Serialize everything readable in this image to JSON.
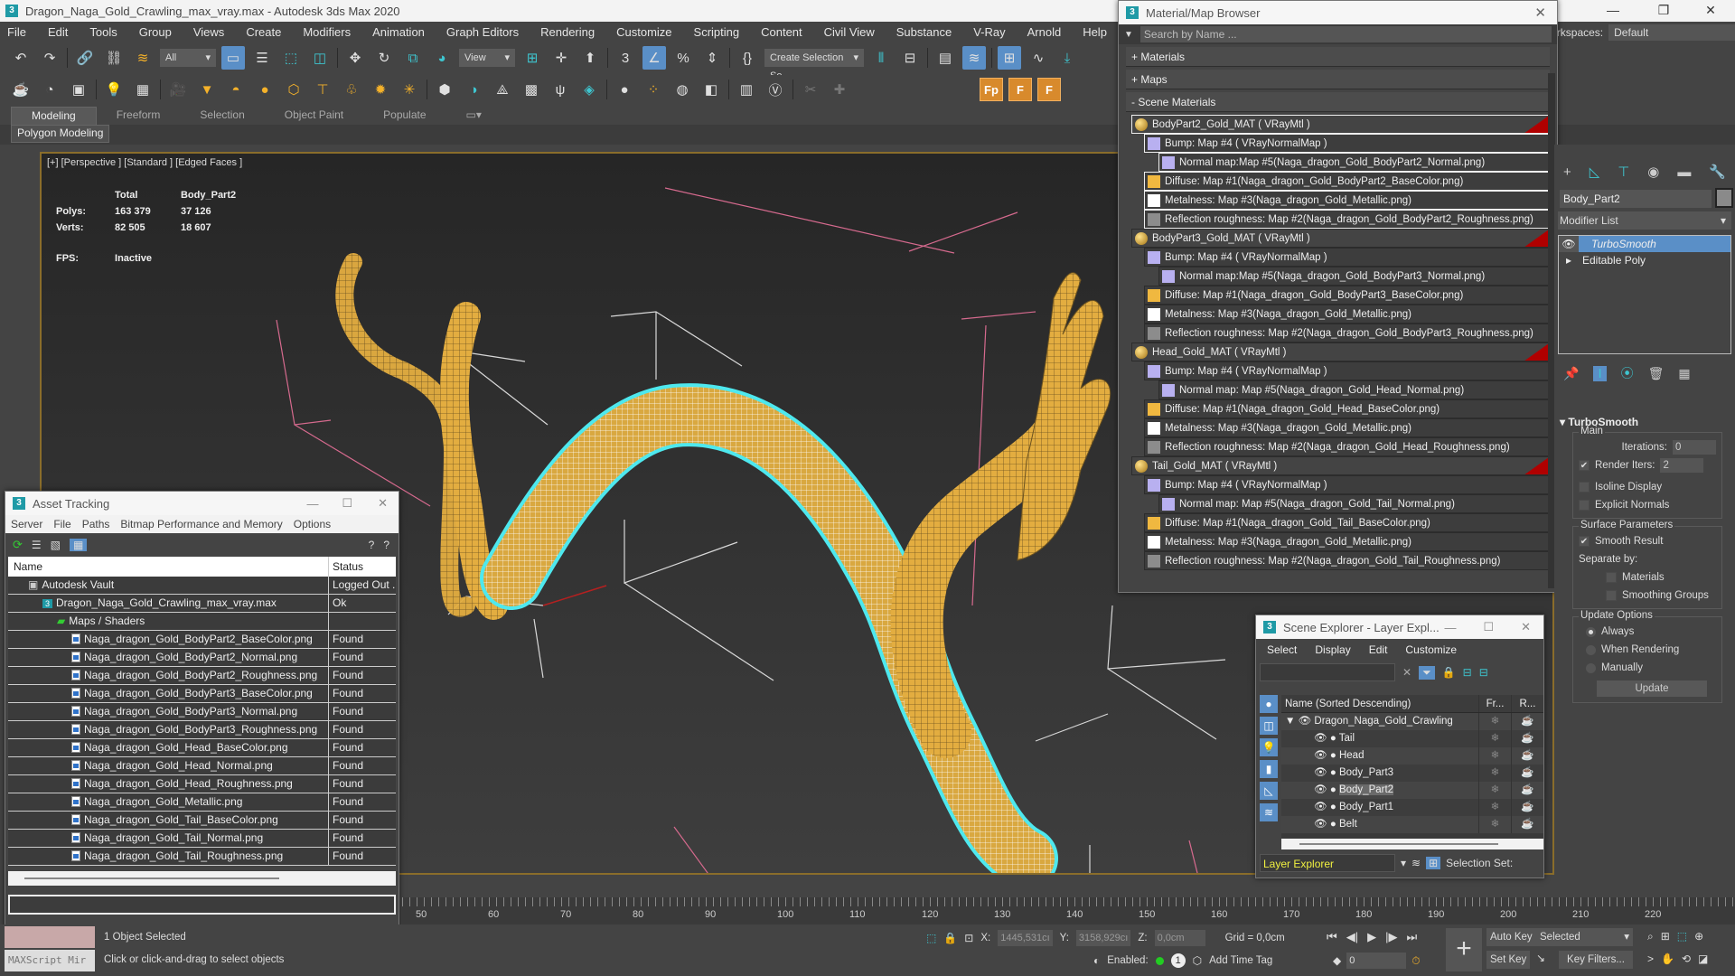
{
  "app": {
    "title": "Dragon_Naga_Gold_Crawling_max_vray.max - Autodesk 3ds Max 2020",
    "menu": [
      "File",
      "Edit",
      "Tools",
      "Group",
      "Views",
      "Create",
      "Modifiers",
      "Animation",
      "Graph Editors",
      "Rendering",
      "Customize",
      "Scripting",
      "Content",
      "Civil View",
      "Substance",
      "V-Ray",
      "Arnold",
      "Help"
    ],
    "workspaces_label": "Workspaces:",
    "workspace_value": "Default"
  },
  "toolbar": {
    "selection_filter": "All",
    "reference_coord": "View",
    "named_selection_sets": "Create Selection Se",
    "fp_buttons": [
      "Fp",
      "F",
      "F"
    ]
  },
  "ribbon": {
    "tabs": [
      "Modeling",
      "Freeform",
      "Selection",
      "Object Paint",
      "Populate"
    ],
    "active_tab": "Modeling",
    "panel": "Polygon Modeling"
  },
  "viewport": {
    "label": "[+] [Perspective ] [Standard ] [Edged Faces ]",
    "stats": {
      "col_total": "Total",
      "col_object": "Body_Part2",
      "polys_label": "Polys:",
      "polys_total": "163 379",
      "polys_object": "37 126",
      "verts_label": "Verts:",
      "verts_total": "82 505",
      "verts_object": "18 607",
      "fps_label": "FPS:",
      "fps_value": "Inactive"
    },
    "colors": {
      "mesh": "#e0aa3a",
      "selection": "#4ee8ee",
      "border": "#8a6d2b"
    }
  },
  "material_browser": {
    "title": "Material/Map Browser",
    "search_placeholder": "Search by Name ...",
    "sections": [
      "+ Materials",
      "+ Maps",
      "- Scene Materials"
    ],
    "materials": [
      {
        "name": "BodyPart2_Gold_MAT  ( VRayMtl )",
        "maps": [
          "Bump: Map #4  ( VRayNormalMap )",
          "Normal map:Map #5(Naga_dragon_Gold_BodyPart2_Normal.png)",
          "Diffuse: Map #1(Naga_dragon_Gold_BodyPart2_BaseColor.png)",
          "Metalness: Map #3(Naga_dragon_Gold_Metallic.png)",
          "Reflection roughness: Map #2(Naga_dragon_Gold_BodyPart2_Roughness.png)"
        ]
      },
      {
        "name": "BodyPart3_Gold_MAT  ( VRayMtl )",
        "maps": [
          "Bump: Map #4  ( VRayNormalMap )",
          "Normal map:Map #5(Naga_dragon_Gold_BodyPart3_Normal.png)",
          "Diffuse: Map #1(Naga_dragon_Gold_BodyPart3_BaseColor.png)",
          "Metalness: Map #3(Naga_dragon_Gold_Metallic.png)",
          "Reflection roughness: Map #2(Naga_dragon_Gold_BodyPart3_Roughness.png)"
        ]
      },
      {
        "name": "Head_Gold_MAT  ( VRayMtl )",
        "maps": [
          "Bump: Map #4  ( VRayNormalMap )",
          "Normal map: Map #5(Naga_dragon_Gold_Head_Normal.png)",
          "Diffuse: Map #1(Naga_dragon_Gold_Head_BaseColor.png)",
          "Metalness: Map #3(Naga_dragon_Gold_Metallic.png)",
          "Reflection roughness: Map #2(Naga_dragon_Gold_Head_Roughness.png)"
        ]
      },
      {
        "name": "Tail_Gold_MAT  ( VRayMtl )",
        "maps": [
          "Bump: Map #4  ( VRayNormalMap )",
          "Normal map: Map #5(Naga_dragon_Gold_Tail_Normal.png)",
          "Diffuse: Map #1(Naga_dragon_Gold_Tail_BaseColor.png)",
          "Metalness: Map #3(Naga_dragon_Gold_Metallic.png)",
          "Reflection roughness: Map #2(Naga_dragon_Gold_Tail_Roughness.png)"
        ]
      }
    ]
  },
  "asset_tracking": {
    "title": "Asset Tracking",
    "menu": [
      "Server",
      "File",
      "Paths",
      "Bitmap Performance and Memory",
      "Options"
    ],
    "columns": [
      "Name",
      "Status"
    ],
    "rows": [
      {
        "name": "Autodesk Vault",
        "status": "Logged Out .",
        "level": 1,
        "icon": "vault"
      },
      {
        "name": "Dragon_Naga_Gold_Crawling_max_vray.max",
        "status": "Ok",
        "level": 2,
        "icon": "max"
      },
      {
        "name": "Maps / Shaders",
        "status": "",
        "level": 3,
        "icon": "maps"
      },
      {
        "name": "Naga_dragon_Gold_BodyPart2_BaseColor.png",
        "status": "Found",
        "level": 4,
        "icon": "file"
      },
      {
        "name": "Naga_dragon_Gold_BodyPart2_Normal.png",
        "status": "Found",
        "level": 4,
        "icon": "file"
      },
      {
        "name": "Naga_dragon_Gold_BodyPart2_Roughness.png",
        "status": "Found",
        "level": 4,
        "icon": "file"
      },
      {
        "name": "Naga_dragon_Gold_BodyPart3_BaseColor.png",
        "status": "Found",
        "level": 4,
        "icon": "file"
      },
      {
        "name": "Naga_dragon_Gold_BodyPart3_Normal.png",
        "status": "Found",
        "level": 4,
        "icon": "file"
      },
      {
        "name": "Naga_dragon_Gold_BodyPart3_Roughness.png",
        "status": "Found",
        "level": 4,
        "icon": "file"
      },
      {
        "name": "Naga_dragon_Gold_Head_BaseColor.png",
        "status": "Found",
        "level": 4,
        "icon": "file"
      },
      {
        "name": "Naga_dragon_Gold_Head_Normal.png",
        "status": "Found",
        "level": 4,
        "icon": "file"
      },
      {
        "name": "Naga_dragon_Gold_Head_Roughness.png",
        "status": "Found",
        "level": 4,
        "icon": "file"
      },
      {
        "name": "Naga_dragon_Gold_Metallic.png",
        "status": "Found",
        "level": 4,
        "icon": "file"
      },
      {
        "name": "Naga_dragon_Gold_Tail_BaseColor.png",
        "status": "Found",
        "level": 4,
        "icon": "file"
      },
      {
        "name": "Naga_dragon_Gold_Tail_Normal.png",
        "status": "Found",
        "level": 4,
        "icon": "file"
      },
      {
        "name": "Naga_dragon_Gold_Tail_Roughness.png",
        "status": "Found",
        "level": 4,
        "icon": "file"
      }
    ]
  },
  "scene_explorer": {
    "title": "Scene Explorer - Layer Expl...",
    "menu": [
      "Select",
      "Display",
      "Edit",
      "Customize"
    ],
    "columns": [
      "Name (Sorted Descending)",
      "Fr...",
      "R..."
    ],
    "root": "Dragon_Naga_Gold_Crawling",
    "objects": [
      "Tail",
      "Head",
      "Body_Part3",
      "Body_Part2",
      "Body_Part1",
      "Belt"
    ],
    "selected": "Body_Part2",
    "explorer_mode": "Layer Explorer",
    "selection_set_label": "Selection Set:"
  },
  "command_panel": {
    "object_name": "Body_Part2",
    "modifier_list_label": "Modifier List",
    "stack": [
      "TurboSmooth",
      "Editable Poly"
    ],
    "selected_modifier": "TurboSmooth",
    "rollout": {
      "title": "TurboSmooth",
      "main_label": "Main",
      "iterations_label": "Iterations:",
      "iterations_value": "0",
      "render_iters_label": "Render Iters:",
      "render_iters_value": "2",
      "render_iters_checked": true,
      "isoline_label": "Isoline Display",
      "explicit_normals_label": "Explicit Normals",
      "surface_label": "Surface Parameters",
      "smooth_result_label": "Smooth Result",
      "separate_by_label": "Separate by:",
      "materials_label": "Materials",
      "smoothing_groups_label": "Smoothing Groups",
      "update_options_label": "Update Options",
      "radio_options": [
        "Always",
        "When Rendering",
        "Manually"
      ],
      "radio_selected": "Always",
      "update_button": "Update"
    }
  },
  "timeline": {
    "ticks": [
      "50",
      "60",
      "70",
      "80",
      "90",
      "100",
      "110",
      "120",
      "130",
      "140",
      "150",
      "160",
      "170",
      "180",
      "190",
      "200",
      "210",
      "220"
    ]
  },
  "status": {
    "maxscript_label": "MAXScript Mir",
    "selection_info": "1 Object Selected",
    "prompt": "Click or click-and-drag to select objects",
    "x_label": "X:",
    "x_value": "1445,531cı",
    "y_label": "Y:",
    "y_value": "3158,929cı",
    "z_label": "Z:",
    "z_value": "0,0cm",
    "grid": "Grid = 0,0cm",
    "enabled_label": "Enabled:",
    "add_time_tag": "Add Time Tag",
    "current_frame": "0",
    "auto_key": "Auto Key",
    "set_key": "Set Key",
    "key_mode": "Selected",
    "key_filters": "Key Filters..."
  }
}
